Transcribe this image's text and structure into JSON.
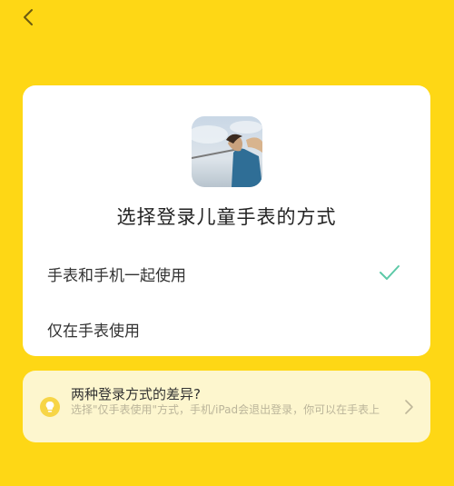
{
  "nav": {
    "back_icon": "chevron-left-icon"
  },
  "card": {
    "avatar": "user-avatar-photo",
    "title": "选择登录儿童手表的方式",
    "options": [
      {
        "label": "手表和手机一起使用",
        "selected": true,
        "icon": "check-icon"
      },
      {
        "label": "仅在手表使用",
        "selected": false
      }
    ]
  },
  "info": {
    "icon": "lightbulb-icon",
    "title": "两种登录方式的差异?",
    "description": "选择\"仅手表使用\"方式，手机/iPad会退出登录，你可以在手表上",
    "chevron_icon": "chevron-right-icon"
  },
  "colors": {
    "background": "#FED715",
    "card": "#FFFFFF",
    "info_card": "#FDF6CE",
    "check": "#5CC9A7",
    "bulb": "#F7D547"
  }
}
